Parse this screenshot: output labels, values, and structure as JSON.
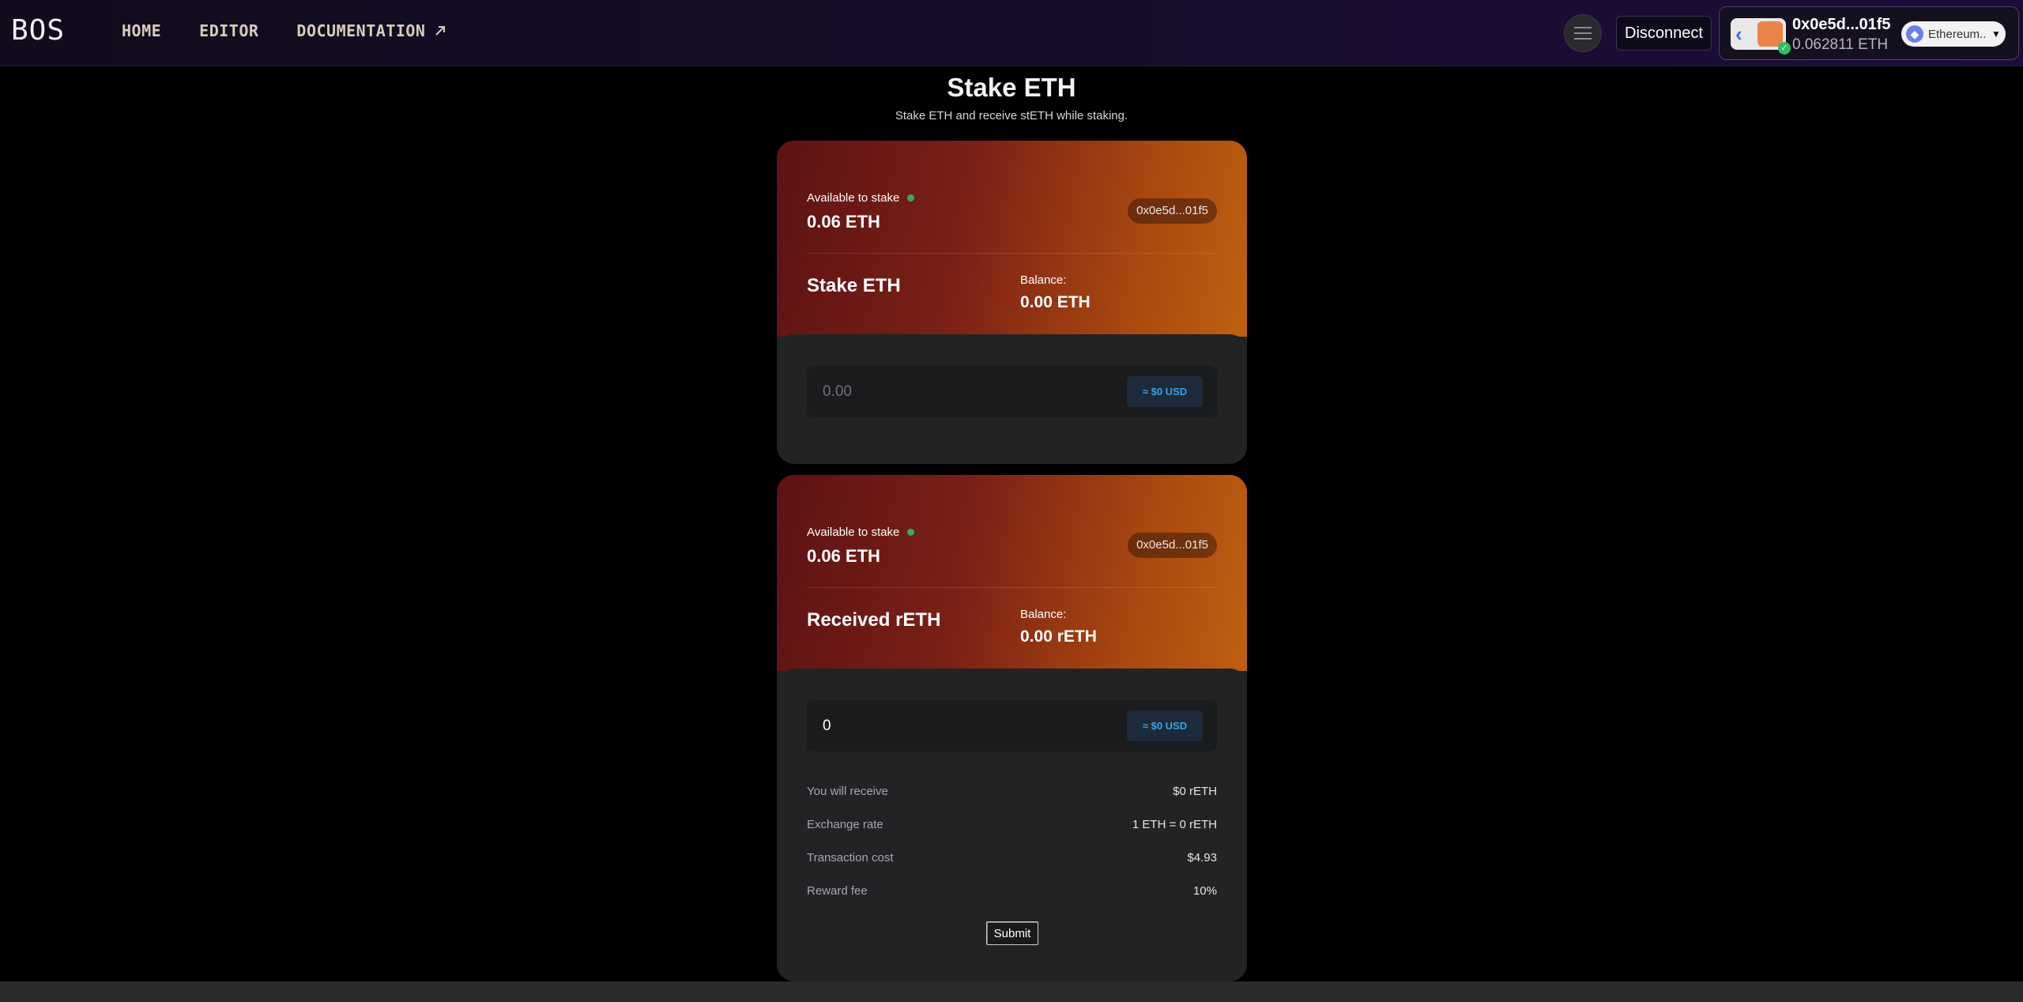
{
  "nav": {
    "logo": "BOS",
    "links": [
      "HOME",
      "EDITOR",
      "DOCUMENTATION"
    ],
    "disconnect_label": "Disconnect",
    "wallet": {
      "address": "0x0e5d...01f5",
      "balance": "0.062811 ETH",
      "network": "Ethereum..."
    }
  },
  "page": {
    "title": "Stake ETH",
    "subtitle": "Stake ETH and receive stETH while staking."
  },
  "stake_card": {
    "available_label": "Available to stake",
    "available_value": "0.06 ETH",
    "address": "0x0e5d...01f5",
    "section_title": "Stake ETH",
    "balance_label": "Balance:",
    "balance_value": "0.00 ETH",
    "input_placeholder": "0.00",
    "usd_label": "≈ $0 USD"
  },
  "receive_card": {
    "available_label": "Available to stake",
    "available_value": "0.06 ETH",
    "address": "0x0e5d...01f5",
    "section_title": "Received rETH",
    "balance_label": "Balance:",
    "balance_value": "0.00 rETH",
    "input_value": "0",
    "usd_label": "≈ $0 USD",
    "info": [
      {
        "key": "You will receive",
        "value": "$0 rETH"
      },
      {
        "key": "Exchange rate",
        "value": "1 ETH = 0 rETH"
      },
      {
        "key": "Transaction cost",
        "value": "$4.93"
      },
      {
        "key": "Reward fee",
        "value": "10%"
      }
    ],
    "submit_label": "Submit"
  },
  "colors": {
    "card_gradient_start": "#5e1214",
    "card_gradient_end": "#bf6010",
    "status_dot": "#38a86a",
    "usd_text": "#3aa0e8"
  }
}
